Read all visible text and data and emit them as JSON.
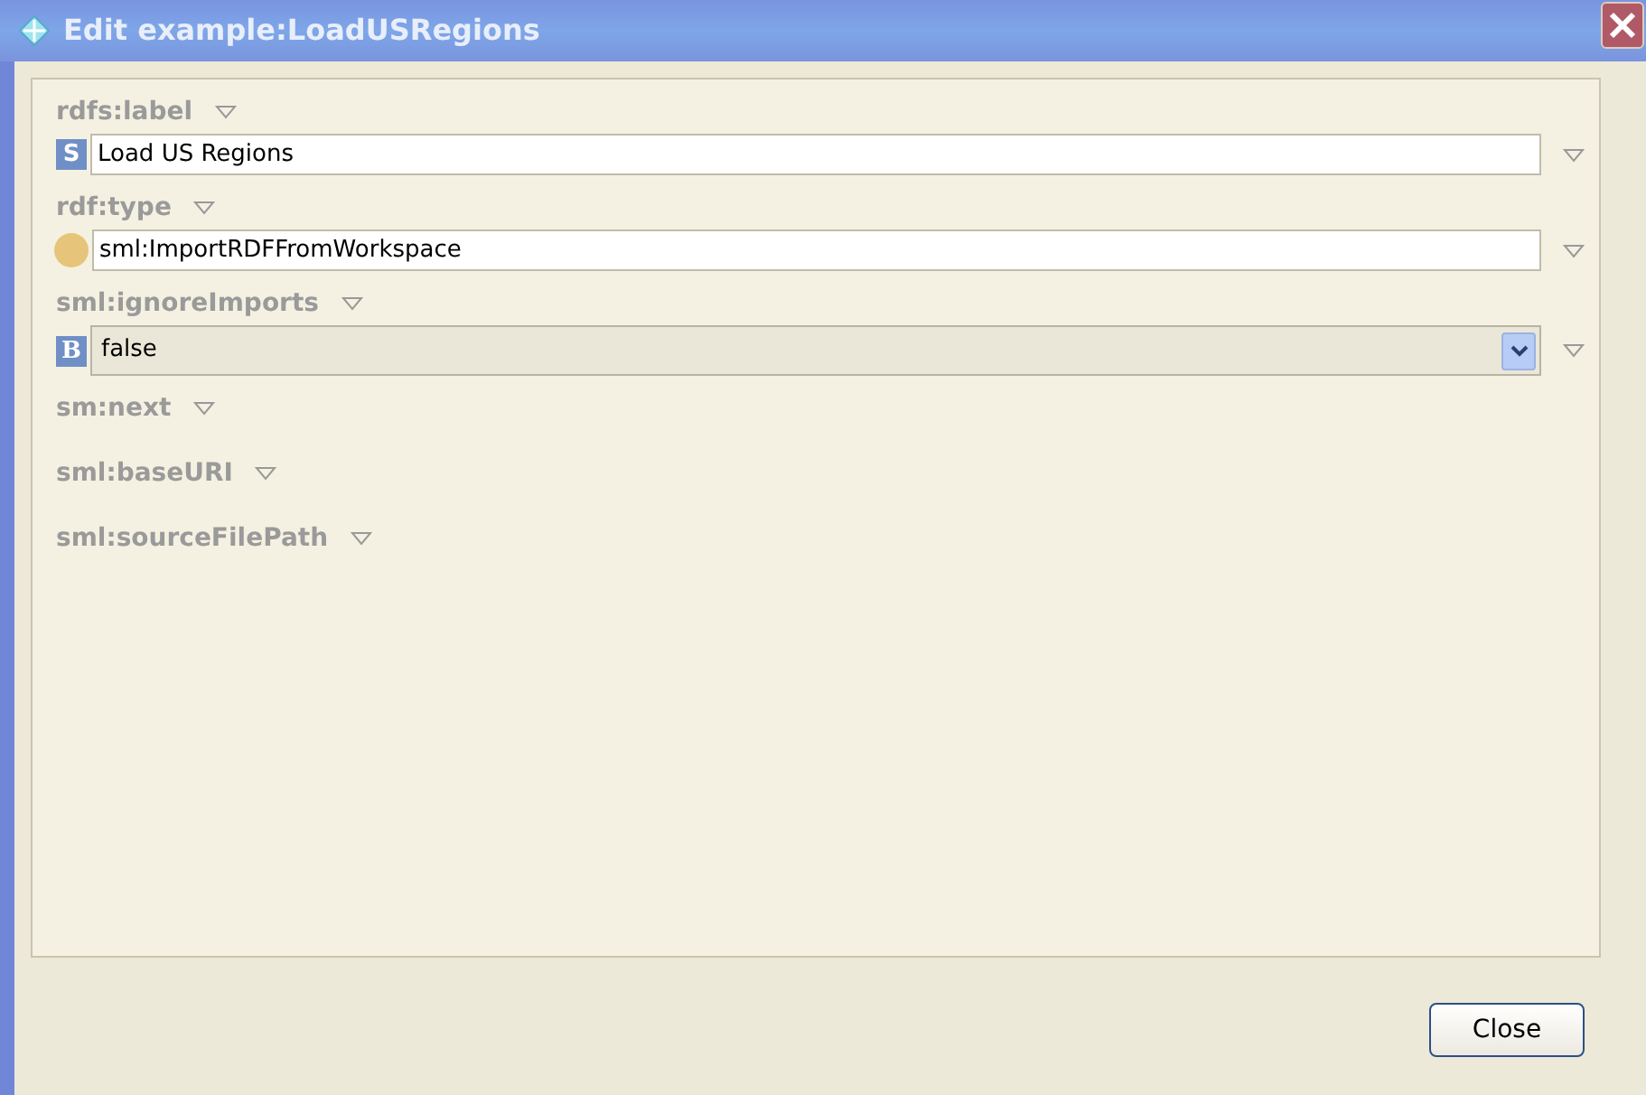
{
  "window": {
    "title": "Edit example:LoadUSRegions"
  },
  "properties": [
    {
      "name": "rdfs:label",
      "value": {
        "kind": "string",
        "badge": "S",
        "text": "Load US Regions"
      }
    },
    {
      "name": "rdf:type",
      "value": {
        "kind": "resource",
        "text": "sml:ImportRDFFromWorkspace"
      }
    },
    {
      "name": "sml:ignoreImports",
      "value": {
        "kind": "boolean",
        "badge": "B",
        "text": "false"
      }
    },
    {
      "name": "sm:next"
    },
    {
      "name": "sml:baseURI"
    },
    {
      "name": "sml:sourceFilePath"
    }
  ],
  "buttons": [
    "Close"
  ]
}
